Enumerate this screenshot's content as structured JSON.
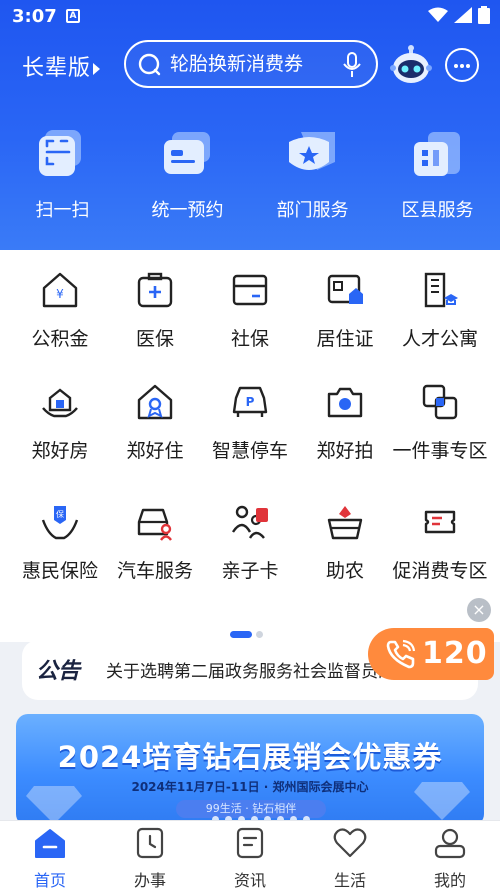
{
  "status_bar": {
    "time": "3:07",
    "notification_letter": "A"
  },
  "header": {
    "elder_mode_label": "长辈版",
    "search": {
      "placeholder": "轮胎换新消费券"
    }
  },
  "quick_actions": [
    {
      "label": "扫一扫",
      "icon": "scan-icon"
    },
    {
      "label": "统一预约",
      "icon": "appointment-card-icon"
    },
    {
      "label": "部门服务",
      "icon": "department-star-icon"
    },
    {
      "label": "区县服务",
      "icon": "district-building-icon"
    }
  ],
  "services": [
    {
      "label": "公积金",
      "icon": "housing-fund-icon"
    },
    {
      "label": "医保",
      "icon": "medical-insurance-icon"
    },
    {
      "label": "社保",
      "icon": "social-security-card-icon"
    },
    {
      "label": "居住证",
      "icon": "residence-permit-icon"
    },
    {
      "label": "人才公寓",
      "icon": "talent-apartment-icon"
    },
    {
      "label": "郑好房",
      "icon": "good-house-icon"
    },
    {
      "label": "郑好住",
      "icon": "good-living-icon"
    },
    {
      "label": "智慧停车",
      "icon": "smart-parking-icon"
    },
    {
      "label": "郑好拍",
      "icon": "camera-icon"
    },
    {
      "label": "一件事专区",
      "icon": "one-thing-zone-icon"
    },
    {
      "label": "惠民保险",
      "icon": "insurance-hands-icon"
    },
    {
      "label": "汽车服务",
      "icon": "car-service-icon"
    },
    {
      "label": "亲子卡",
      "icon": "parent-child-card-icon"
    },
    {
      "label": "助农",
      "icon": "farm-basket-icon"
    },
    {
      "label": "促消费专区",
      "icon": "coupon-icon"
    }
  ],
  "notice": {
    "title": "公告",
    "text": "关于选聘第二届政务服务社会监督员的公告"
  },
  "emergency_call": {
    "number": "120"
  },
  "banner": {
    "title": "2024培育钻石展销会优惠券",
    "subtitle": "2024年11月7日-11日 · 郑州国际会展中心",
    "tag": "99生活 · 钻石相伴"
  },
  "bottom_nav": [
    {
      "label": "首页",
      "icon": "home-icon",
      "active": true
    },
    {
      "label": "办事",
      "icon": "clock-icon",
      "active": false
    },
    {
      "label": "资讯",
      "icon": "news-icon",
      "active": false
    },
    {
      "label": "生活",
      "icon": "heart-icon",
      "active": false
    },
    {
      "label": "我的",
      "icon": "profile-icon",
      "active": false
    }
  ],
  "colors": {
    "brand_blue": "#2a66f5",
    "emergency_orange": "#ff8a3d"
  }
}
